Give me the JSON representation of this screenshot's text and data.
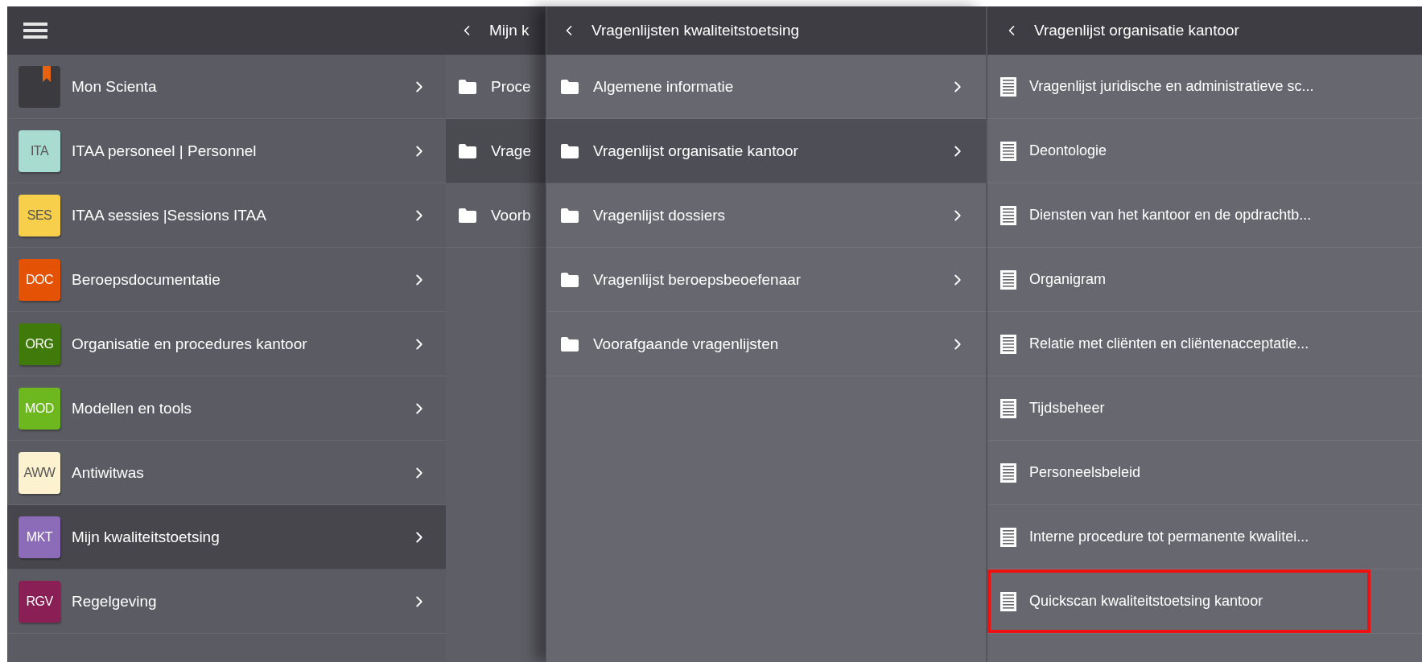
{
  "sidebar": {
    "items": [
      {
        "kind": "bookmark",
        "label": "Mon Scienta",
        "selected": false
      },
      {
        "kind": "badge",
        "badge": "ITA",
        "color": "#a8dcd1",
        "label": "ITAA personeel | Personnel",
        "selected": false
      },
      {
        "kind": "badge",
        "badge": "SES",
        "color": "#f7cf4a",
        "label": "ITAA sessies |Sessions ITAA",
        "selected": false
      },
      {
        "kind": "badge",
        "badge": "DOC",
        "color": "#e35205",
        "label": "Beroepsdocumentatie",
        "selected": false
      },
      {
        "kind": "badge",
        "badge": "ORG",
        "color": "#3f7a0a",
        "label": "Organisatie en procedures kantoor",
        "selected": false
      },
      {
        "kind": "badge",
        "badge": "MOD",
        "color": "#6cb81e",
        "label": "Modellen en tools",
        "selected": false
      },
      {
        "kind": "badge",
        "badge": "AWW",
        "color": "#fdf2cf",
        "label": "Antiwitwas",
        "selected": false
      },
      {
        "kind": "badge",
        "badge": "MKT",
        "color": "#8c6bb8",
        "label": "Mijn kwaliteitstoetsing",
        "selected": true
      },
      {
        "kind": "badge",
        "badge": "RGV",
        "color": "#8a1f55",
        "label": "Regelgeving",
        "selected": false
      }
    ]
  },
  "column_2": {
    "title": "Mijn k",
    "items": [
      {
        "label": "Proce",
        "selected": false
      },
      {
        "label": "Vrage",
        "selected": true
      },
      {
        "label": "Voorb",
        "selected": false
      }
    ]
  },
  "column_3": {
    "title": "Vragenlijsten kwaliteitstoetsing",
    "items": [
      {
        "label": "Algemene informatie",
        "selected": false
      },
      {
        "label": "Vragenlijst organisatie kantoor",
        "selected": true
      },
      {
        "label": "Vragenlijst dossiers",
        "selected": false
      },
      {
        "label": "Vragenlijst beroepsbeoefenaar",
        "selected": false
      },
      {
        "label": "Voorafgaande vragenlijsten",
        "selected": false
      }
    ]
  },
  "column_4": {
    "title": "Vragenlijst organisatie kantoor",
    "items": [
      {
        "label": "Vragenlijst juridische en administratieve sc...",
        "highlighted": false
      },
      {
        "label": "Deontologie",
        "highlighted": false
      },
      {
        "label": "Diensten van het kantoor en de opdrachtb...",
        "highlighted": false
      },
      {
        "label": "Organigram",
        "highlighted": false
      },
      {
        "label": "Relatie met cliënten en cliëntenacceptatie...",
        "highlighted": false
      },
      {
        "label": "Tijdsbeheer",
        "highlighted": false
      },
      {
        "label": "Personeelsbeleid",
        "highlighted": false
      },
      {
        "label": "Interne procedure tot permanente kwalitei...",
        "highlighted": false
      },
      {
        "label": "Quickscan kwaliteitstoetsing kantoor",
        "highlighted": true
      }
    ]
  }
}
